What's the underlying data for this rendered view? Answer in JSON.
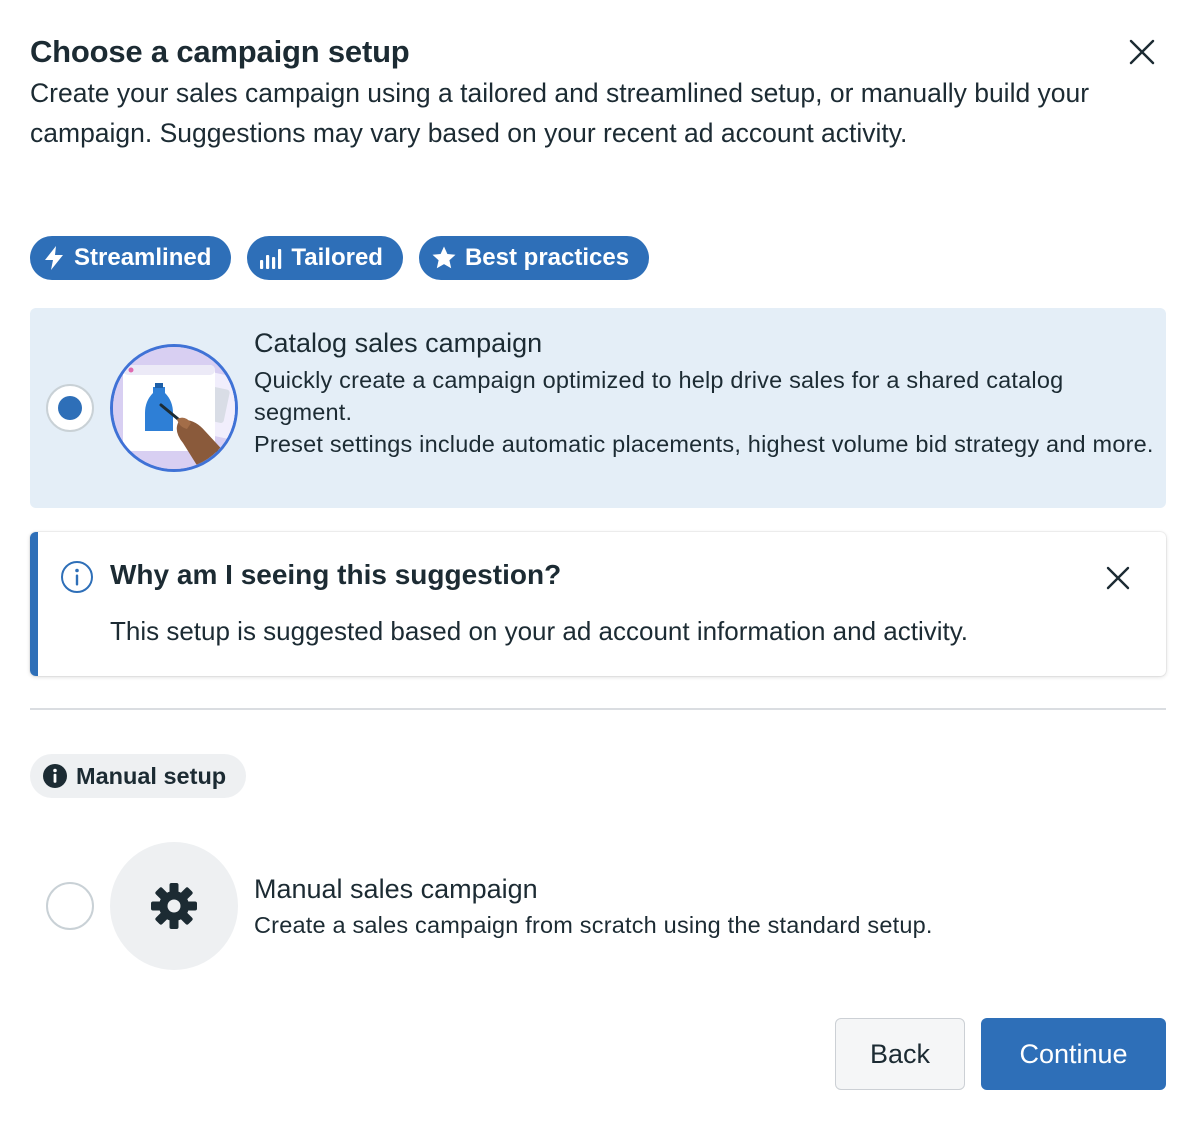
{
  "dialog": {
    "title": "Choose a campaign setup",
    "subtitle": "Create your sales campaign using a tailored and streamlined setup, or manually build your campaign. Suggestions may vary based on your recent ad account activity.",
    "close_icon": "close-icon"
  },
  "pills": [
    {
      "label": "Streamlined",
      "icon": "lightning-icon"
    },
    {
      "label": "Tailored",
      "icon": "bar-chart-icon"
    },
    {
      "label": "Best practices",
      "icon": "star-icon"
    }
  ],
  "suggested_option": {
    "title": "Catalog sales campaign",
    "description_line1": "Quickly create a campaign optimized to help drive sales for a shared catalog segment.",
    "description_line2": "Preset settings include automatic placements, highest volume bid strategy and more.",
    "selected": true
  },
  "notice": {
    "title": "Why am I seeing this suggestion?",
    "body": "This setup is suggested based on your ad account information and activity."
  },
  "manual_section": {
    "chip_label": "Manual setup"
  },
  "manual_option": {
    "title": "Manual sales campaign",
    "description": "Create a sales campaign from scratch using the standard setup.",
    "selected": false
  },
  "footer": {
    "back_label": "Back",
    "continue_label": "Continue"
  },
  "colors": {
    "accent": "#2e6fb8",
    "selected_card_bg": "#e4eef7"
  }
}
